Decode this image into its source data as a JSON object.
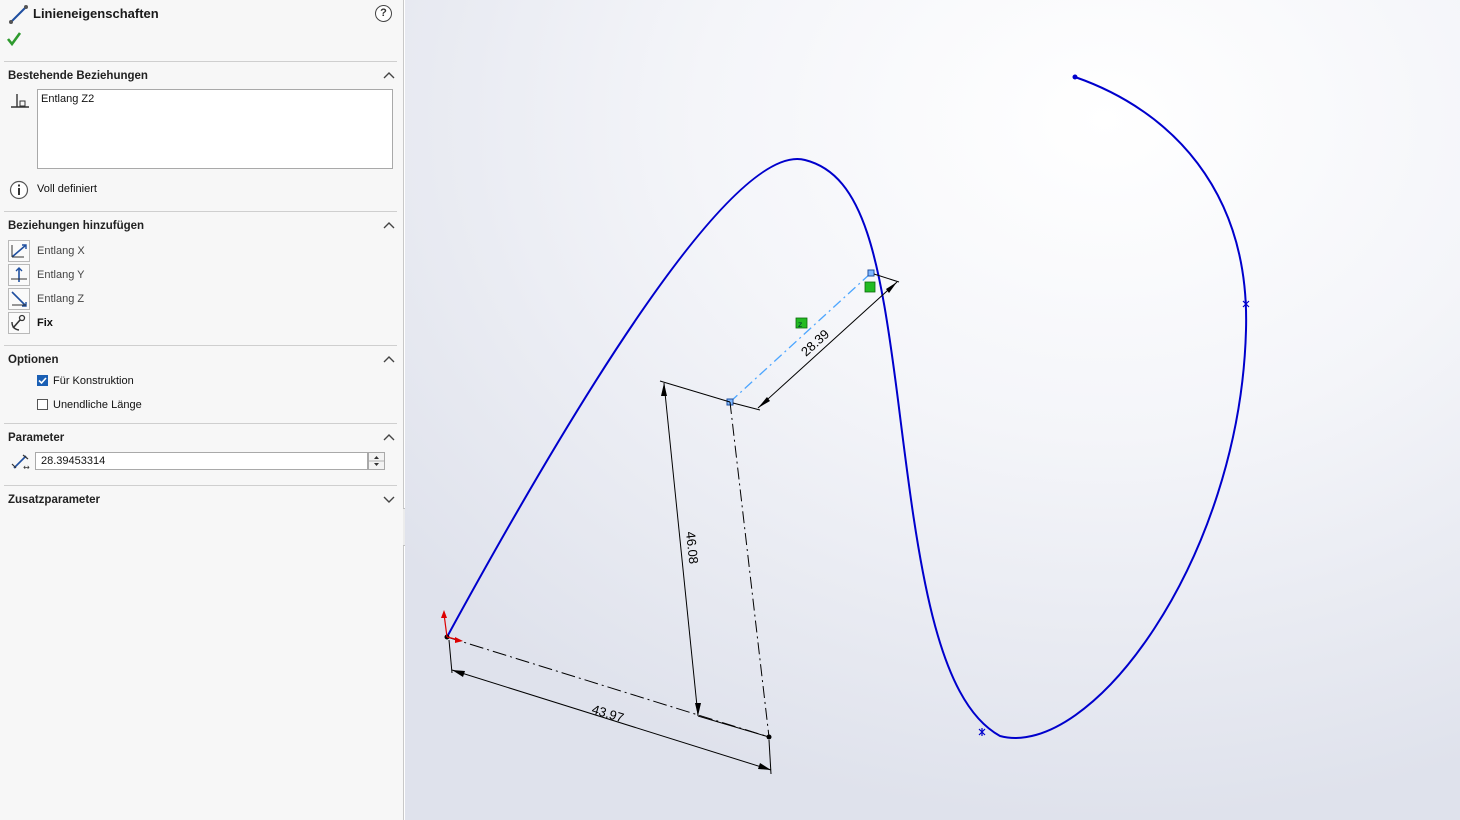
{
  "panel": {
    "title": "Linieneigenschaften",
    "help_icon": "help-icon",
    "ok_icon": "checkmark-icon",
    "existing_relations": {
      "title": "Bestehende Beziehungen",
      "items": [
        "Entlang Z2"
      ],
      "status": "Voll definiert"
    },
    "add_relations": {
      "title": "Beziehungen hinzufügen",
      "items": [
        {
          "label": "Entlang X",
          "icon": "along-x-icon"
        },
        {
          "label": "Entlang Y",
          "icon": "along-y-icon"
        },
        {
          "label": "Entlang Z",
          "icon": "along-z-icon"
        },
        {
          "label": "Fix",
          "icon": "fix-anchor-icon"
        }
      ]
    },
    "options": {
      "title": "Optionen",
      "for_construction": {
        "label": "Für Konstruktion",
        "checked": true
      },
      "infinite_length": {
        "label": "Unendliche Länge",
        "checked": false
      }
    },
    "parameters": {
      "title": "Parameter",
      "length_value": "28.39453314"
    },
    "additional_parameters": {
      "title": "Zusatzparameter"
    }
  },
  "dimensions": {
    "d1": "28.39",
    "d2": "46.08",
    "d3": "43.97"
  },
  "colors": {
    "curve": "#0000cc",
    "construction_line": "#4da6ff",
    "dimension": "#000000",
    "selected_point": "#22bb22",
    "origin_arrow": "#dd0000"
  }
}
